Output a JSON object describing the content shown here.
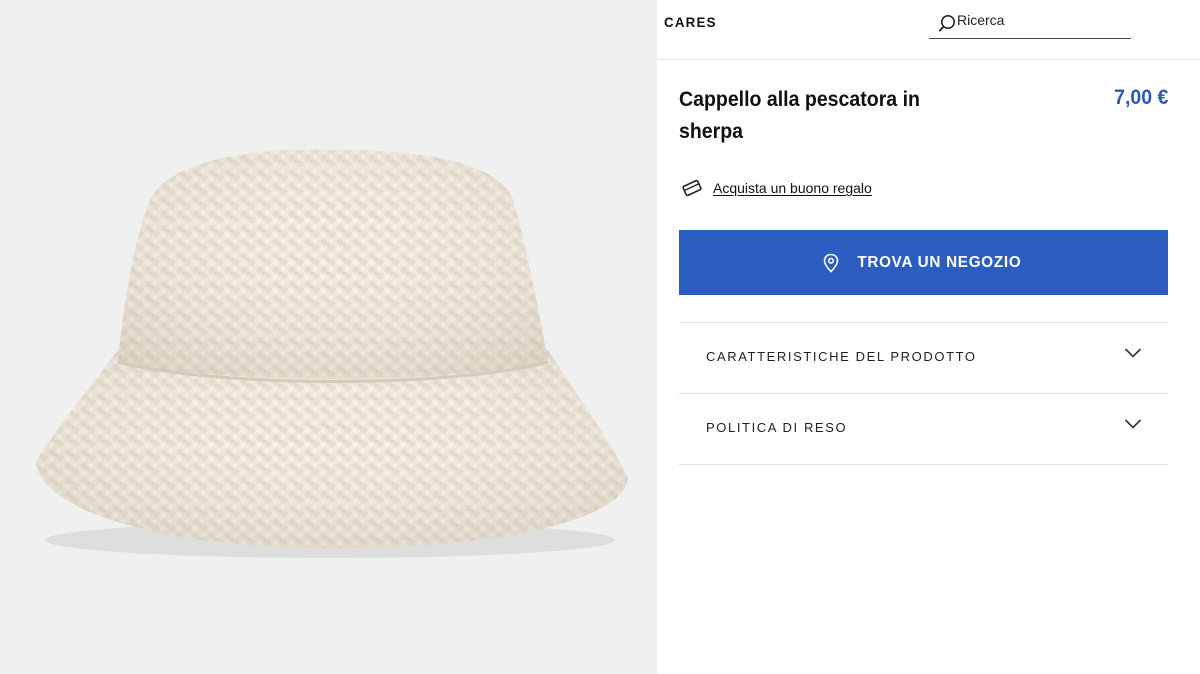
{
  "product_image": {
    "background": "#f0f0f0",
    "hat_color": "#efe9dc"
  },
  "header": {
    "brand": "CARES",
    "search": {
      "placeholder": "Ricerca",
      "icon": "search-icon"
    }
  },
  "product": {
    "title": "Cappello alla pescatora in sherpa",
    "price": "7,00 €",
    "price_color": "#2a59b8"
  },
  "gift": {
    "icon": "gift-card-icon",
    "label": "Acquista un buono regalo"
  },
  "store_button": {
    "icon": "location-pin-icon",
    "label": "TROVA UN NEGOZIO",
    "color": "#2c5ec2"
  },
  "accordion": {
    "items": [
      {
        "label": "CARATTERISTICHE DEL PRODOTTO",
        "icon": "chevron-down-icon"
      },
      {
        "label": "POLITICA DI RESO",
        "icon": "chevron-down-icon"
      }
    ]
  }
}
